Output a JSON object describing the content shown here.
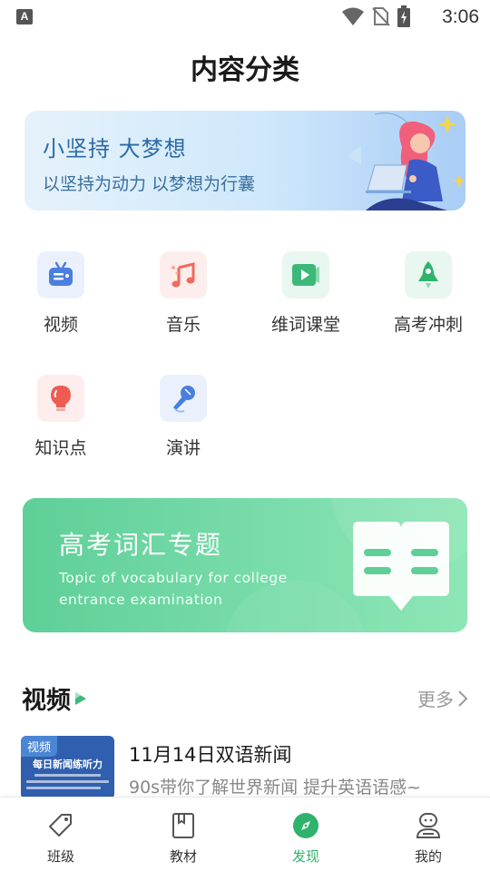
{
  "status_bar": {
    "time": "3:06",
    "left_badge": "A",
    "icons": [
      "wifi-icon",
      "no-sim-icon",
      "battery-charging-icon"
    ]
  },
  "page": {
    "title": "内容分类"
  },
  "banner": {
    "title": "小坚持 大梦想",
    "subtitle": "以坚持为动力 以梦想为行囊"
  },
  "categories": [
    {
      "label": "视频",
      "icon": "tv-icon",
      "color": "#4a7fe0",
      "bg": "#eaf1fd"
    },
    {
      "label": "音乐",
      "icon": "music-note-icon",
      "color": "#f06a5d",
      "bg": "#fdeeed"
    },
    {
      "label": "维词课堂",
      "icon": "video-play-icon",
      "color": "#3cb878",
      "bg": "#e8f7ef"
    },
    {
      "label": "高考冲刺",
      "icon": "rocket-icon",
      "color": "#2fb36c",
      "bg": "#e8f7ef"
    },
    {
      "label": "知识点",
      "icon": "lightbulb-icon",
      "color": "#f05b52",
      "bg": "#fdeeed"
    },
    {
      "label": "演讲",
      "icon": "microphone-icon",
      "color": "#4a7fe0",
      "bg": "#eaf1fd"
    }
  ],
  "vocab_card": {
    "title": "高考词汇专题",
    "subtitle": "Topic of vocabulary for college entrance examination"
  },
  "video_section": {
    "title": "视频",
    "more_label": "更多",
    "items": [
      {
        "badge": "视频",
        "thumb_text": "每日新闻练听力",
        "title": "11月14日双语新闻",
        "description": "90s带你了解世界新闻 提升英语语感~"
      }
    ]
  },
  "bottom_nav": {
    "active": "发现",
    "accent": "#2fb36c",
    "items": [
      {
        "label": "班级",
        "icon": "tag-icon"
      },
      {
        "label": "教材",
        "icon": "book-icon"
      },
      {
        "label": "发现",
        "icon": "compass-icon"
      },
      {
        "label": "我的",
        "icon": "profile-icon"
      }
    ]
  }
}
